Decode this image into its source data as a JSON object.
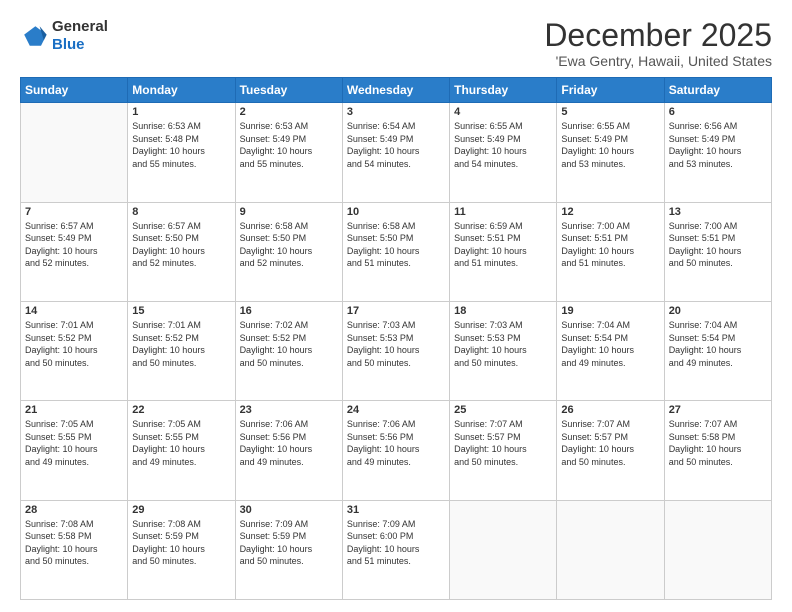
{
  "header": {
    "logo_general": "General",
    "logo_blue": "Blue",
    "main_title": "December 2025",
    "subtitle": "'Ewa Gentry, Hawaii, United States"
  },
  "calendar": {
    "days_of_week": [
      "Sunday",
      "Monday",
      "Tuesday",
      "Wednesday",
      "Thursday",
      "Friday",
      "Saturday"
    ],
    "weeks": [
      [
        {
          "day": "",
          "info": ""
        },
        {
          "day": "1",
          "info": "Sunrise: 6:53 AM\nSunset: 5:48 PM\nDaylight: 10 hours\nand 55 minutes."
        },
        {
          "day": "2",
          "info": "Sunrise: 6:53 AM\nSunset: 5:49 PM\nDaylight: 10 hours\nand 55 minutes."
        },
        {
          "day": "3",
          "info": "Sunrise: 6:54 AM\nSunset: 5:49 PM\nDaylight: 10 hours\nand 54 minutes."
        },
        {
          "day": "4",
          "info": "Sunrise: 6:55 AM\nSunset: 5:49 PM\nDaylight: 10 hours\nand 54 minutes."
        },
        {
          "day": "5",
          "info": "Sunrise: 6:55 AM\nSunset: 5:49 PM\nDaylight: 10 hours\nand 53 minutes."
        },
        {
          "day": "6",
          "info": "Sunrise: 6:56 AM\nSunset: 5:49 PM\nDaylight: 10 hours\nand 53 minutes."
        }
      ],
      [
        {
          "day": "7",
          "info": "Sunrise: 6:57 AM\nSunset: 5:49 PM\nDaylight: 10 hours\nand 52 minutes."
        },
        {
          "day": "8",
          "info": "Sunrise: 6:57 AM\nSunset: 5:50 PM\nDaylight: 10 hours\nand 52 minutes."
        },
        {
          "day": "9",
          "info": "Sunrise: 6:58 AM\nSunset: 5:50 PM\nDaylight: 10 hours\nand 52 minutes."
        },
        {
          "day": "10",
          "info": "Sunrise: 6:58 AM\nSunset: 5:50 PM\nDaylight: 10 hours\nand 51 minutes."
        },
        {
          "day": "11",
          "info": "Sunrise: 6:59 AM\nSunset: 5:51 PM\nDaylight: 10 hours\nand 51 minutes."
        },
        {
          "day": "12",
          "info": "Sunrise: 7:00 AM\nSunset: 5:51 PM\nDaylight: 10 hours\nand 51 minutes."
        },
        {
          "day": "13",
          "info": "Sunrise: 7:00 AM\nSunset: 5:51 PM\nDaylight: 10 hours\nand 50 minutes."
        }
      ],
      [
        {
          "day": "14",
          "info": "Sunrise: 7:01 AM\nSunset: 5:52 PM\nDaylight: 10 hours\nand 50 minutes."
        },
        {
          "day": "15",
          "info": "Sunrise: 7:01 AM\nSunset: 5:52 PM\nDaylight: 10 hours\nand 50 minutes."
        },
        {
          "day": "16",
          "info": "Sunrise: 7:02 AM\nSunset: 5:52 PM\nDaylight: 10 hours\nand 50 minutes."
        },
        {
          "day": "17",
          "info": "Sunrise: 7:03 AM\nSunset: 5:53 PM\nDaylight: 10 hours\nand 50 minutes."
        },
        {
          "day": "18",
          "info": "Sunrise: 7:03 AM\nSunset: 5:53 PM\nDaylight: 10 hours\nand 50 minutes."
        },
        {
          "day": "19",
          "info": "Sunrise: 7:04 AM\nSunset: 5:54 PM\nDaylight: 10 hours\nand 49 minutes."
        },
        {
          "day": "20",
          "info": "Sunrise: 7:04 AM\nSunset: 5:54 PM\nDaylight: 10 hours\nand 49 minutes."
        }
      ],
      [
        {
          "day": "21",
          "info": "Sunrise: 7:05 AM\nSunset: 5:55 PM\nDaylight: 10 hours\nand 49 minutes."
        },
        {
          "day": "22",
          "info": "Sunrise: 7:05 AM\nSunset: 5:55 PM\nDaylight: 10 hours\nand 49 minutes."
        },
        {
          "day": "23",
          "info": "Sunrise: 7:06 AM\nSunset: 5:56 PM\nDaylight: 10 hours\nand 49 minutes."
        },
        {
          "day": "24",
          "info": "Sunrise: 7:06 AM\nSunset: 5:56 PM\nDaylight: 10 hours\nand 49 minutes."
        },
        {
          "day": "25",
          "info": "Sunrise: 7:07 AM\nSunset: 5:57 PM\nDaylight: 10 hours\nand 50 minutes."
        },
        {
          "day": "26",
          "info": "Sunrise: 7:07 AM\nSunset: 5:57 PM\nDaylight: 10 hours\nand 50 minutes."
        },
        {
          "day": "27",
          "info": "Sunrise: 7:07 AM\nSunset: 5:58 PM\nDaylight: 10 hours\nand 50 minutes."
        }
      ],
      [
        {
          "day": "28",
          "info": "Sunrise: 7:08 AM\nSunset: 5:58 PM\nDaylight: 10 hours\nand 50 minutes."
        },
        {
          "day": "29",
          "info": "Sunrise: 7:08 AM\nSunset: 5:59 PM\nDaylight: 10 hours\nand 50 minutes."
        },
        {
          "day": "30",
          "info": "Sunrise: 7:09 AM\nSunset: 5:59 PM\nDaylight: 10 hours\nand 50 minutes."
        },
        {
          "day": "31",
          "info": "Sunrise: 7:09 AM\nSunset: 6:00 PM\nDaylight: 10 hours\nand 51 minutes."
        },
        {
          "day": "",
          "info": ""
        },
        {
          "day": "",
          "info": ""
        },
        {
          "day": "",
          "info": ""
        }
      ]
    ]
  }
}
